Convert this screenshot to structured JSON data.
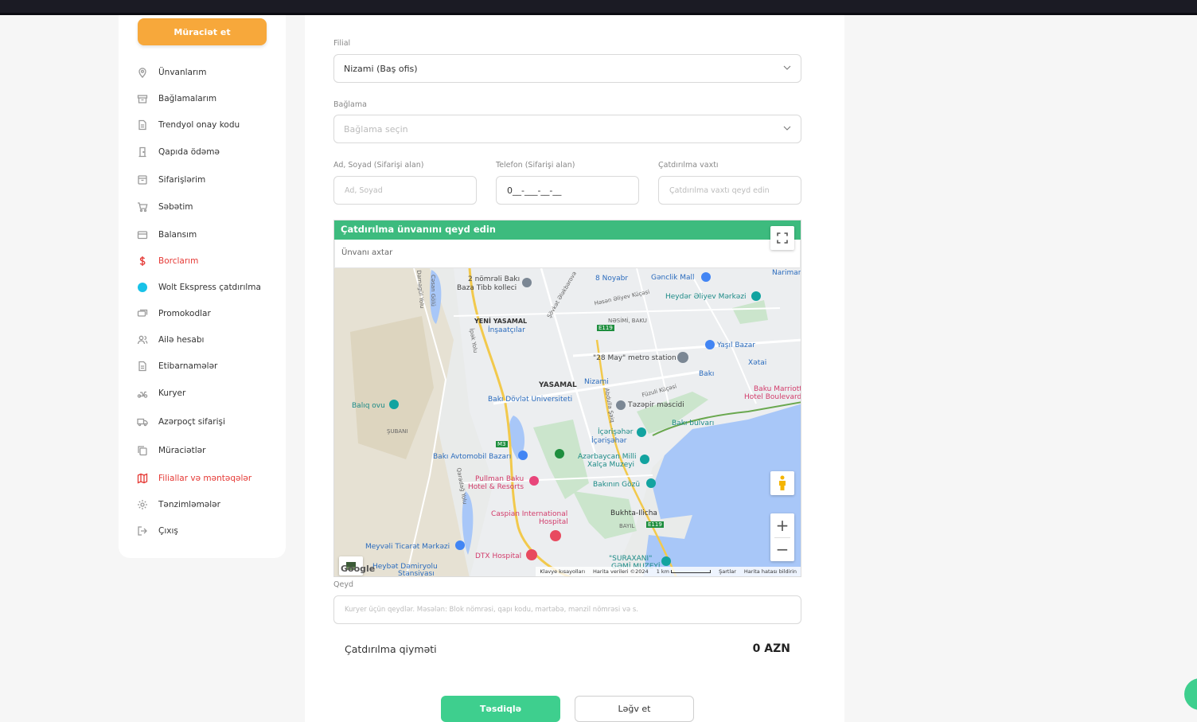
{
  "sidebar": {
    "apply_button": "Müraciət et",
    "items": [
      {
        "label": "Ünvanlarım",
        "icon": "location-pin-icon"
      },
      {
        "label": "Bağlamalarım",
        "icon": "box-icon"
      },
      {
        "label": "Trendyol onay kodu",
        "icon": "document-icon"
      },
      {
        "label": "Qapıda ödəmə",
        "icon": "door-icon"
      },
      {
        "label": "Sifarişlərim",
        "icon": "order-box-icon"
      },
      {
        "label": "Səbətim",
        "icon": "cart-icon"
      },
      {
        "label": "Balansım",
        "icon": "wallet-icon"
      },
      {
        "label": "Borclarım",
        "icon": "dollar-icon"
      },
      {
        "label": "Wolt Ekspress çatdırılma",
        "icon": "wolt-icon"
      },
      {
        "label": "Promokodlar",
        "icon": "coupon-icon"
      },
      {
        "label": "Ailə hesabı",
        "icon": "users-icon"
      },
      {
        "label": "Etibarnamələr",
        "icon": "file-icon"
      },
      {
        "label": "Kuryer",
        "icon": "scooter-icon"
      },
      {
        "label": "Azərpoçt sifarişi",
        "icon": "truck-icon"
      },
      {
        "label": "Müraciətlər",
        "icon": "copy-icon"
      },
      {
        "label": "Filiallar və məntəqələr",
        "icon": "map-icon"
      },
      {
        "label": "Tənzimləmələr",
        "icon": "gear-icon"
      },
      {
        "label": "Çıxış",
        "icon": "logout-icon"
      }
    ]
  },
  "form": {
    "branch_label": "Filial",
    "branch_value": "Nizami (Baş ofis)",
    "package_label": "Bağlama",
    "package_placeholder": "Bağlama seçin",
    "name_label": "Ad, Soyad (Sifarişi alan)",
    "name_placeholder": "Ad, Soyad",
    "phone_label": "Telefon (Sifarişi alan)",
    "phone_value": "0__-___-__-__",
    "time_label": "Çatdırılma vaxtı",
    "time_placeholder": "Çatdırılma vaxtı qeyd edin",
    "map_title": "Çatdırılma ünvanını qeyd edin",
    "map_search_placeholder": "Ünvanı axtar",
    "note_label": "Qeyd",
    "note_placeholder": "Kuryer üçün qeydlər. Məsələn: Blok nömrəsi, qapı kodu, mərtəbə, mənzil nömrəsi və s.",
    "price_label": "Çatdırılma qiyməti",
    "price_value": "0 AZN",
    "confirm_button": "Təsdiqlə",
    "cancel_button": "Ləğv et"
  },
  "map": {
    "labels": {
      "l1": "2 nömrəli Bakı",
      "l2": "Baza Tibb kolleci",
      "l3": "8 Noyabr",
      "l4": "Gənclik Mall",
      "l5": "Nariman",
      "l6": "Heydər Əliyev Mərkəzi",
      "l7": "YENİ YASAMAL",
      "l8": "İnşaatçılar",
      "l9": "NƏSİMİ, BAKU",
      "l10": "Yaşıl Bazar",
      "l11": "\"28 May\" metro station",
      "l12": "Xətai",
      "l13": "Bakı",
      "l14": "Nizami",
      "l15": "YASAMAL",
      "l16": "Bakı Dövlət Universiteti",
      "l17": "Təzəpir məscidi",
      "l18": "Baku Marriott",
      "l19": "Hotel Boulevard",
      "l20": "Balıq ovu",
      "l21": "ŞUBANI",
      "l22": "Bakı bulvarı",
      "l23": "İçərişəhər",
      "l24": "İçərişəhər",
      "l25": "Bakı Avtomobil Bazarı",
      "l26": "Azərbaycan Milli",
      "l27": "Xalça Muzeyi",
      "l28": "Pullman Baku",
      "l29": "Hotel & Resorts",
      "l30": "Bakının Gözü",
      "l31": "Caspian International",
      "l32": "Hospital",
      "l33": "Bukhta-Ilicha",
      "l34": "BAYIL",
      "l35": "Meyvəli Ticarət Mərkəzi",
      "l36": "DTX Hospital",
      "l37": "\"SURAXANI\"",
      "l38": "GƏMİ MUZEYİ",
      "l39": "Heybət Dəmiryolu",
      "l40": "Stansiyası",
      "l41": "Cəsan Gölü",
      "l42": "İpək Yolu",
      "l43": "Füzuli Küçəsi",
      "l44": "Darnagül Yolu",
      "l45": "Həsən Əliyev Küçəsi",
      "l46": "Abdulla Şaiq",
      "l47": "Şövkət Ələkbərova",
      "l48": "Qaradağ Yolu",
      "l49": "E119",
      "l50": "M3",
      "l51": "E119"
    },
    "attribution": {
      "shortcuts": "Klavye kısayolları",
      "data": "Harita verileri ©2024",
      "scale": "1 km",
      "terms": "Şartlar",
      "report": "Harita hatası bildirin"
    },
    "logo": "Google",
    "zoom_in": "+",
    "zoom_out": "−"
  }
}
